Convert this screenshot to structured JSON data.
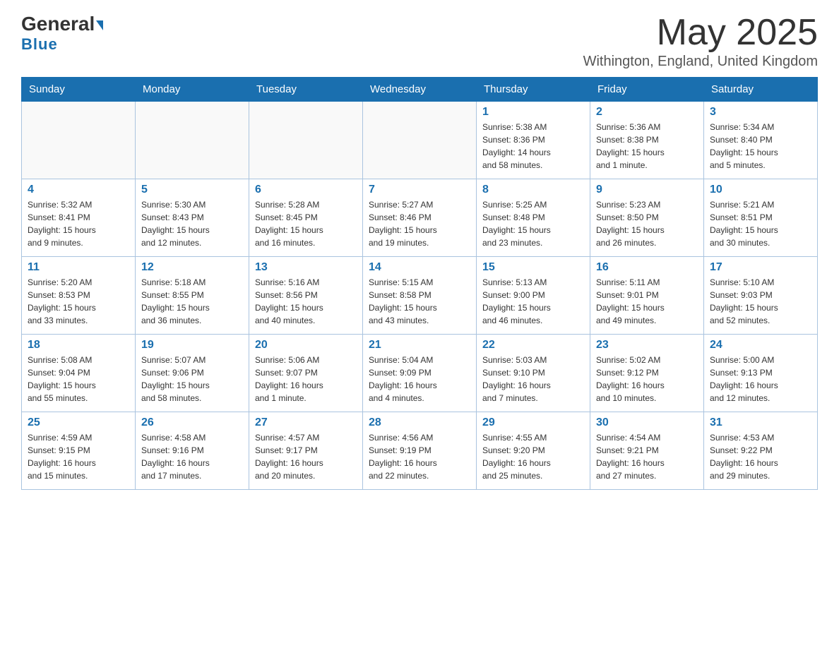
{
  "header": {
    "logo_text1": "General",
    "logo_text2": "Blue",
    "month_title": "May 2025",
    "location": "Withington, England, United Kingdom"
  },
  "weekdays": [
    "Sunday",
    "Monday",
    "Tuesday",
    "Wednesday",
    "Thursday",
    "Friday",
    "Saturday"
  ],
  "weeks": [
    {
      "days": [
        {
          "number": "",
          "info": ""
        },
        {
          "number": "",
          "info": ""
        },
        {
          "number": "",
          "info": ""
        },
        {
          "number": "",
          "info": ""
        },
        {
          "number": "1",
          "info": "Sunrise: 5:38 AM\nSunset: 8:36 PM\nDaylight: 14 hours\nand 58 minutes."
        },
        {
          "number": "2",
          "info": "Sunrise: 5:36 AM\nSunset: 8:38 PM\nDaylight: 15 hours\nand 1 minute."
        },
        {
          "number": "3",
          "info": "Sunrise: 5:34 AM\nSunset: 8:40 PM\nDaylight: 15 hours\nand 5 minutes."
        }
      ]
    },
    {
      "days": [
        {
          "number": "4",
          "info": "Sunrise: 5:32 AM\nSunset: 8:41 PM\nDaylight: 15 hours\nand 9 minutes."
        },
        {
          "number": "5",
          "info": "Sunrise: 5:30 AM\nSunset: 8:43 PM\nDaylight: 15 hours\nand 12 minutes."
        },
        {
          "number": "6",
          "info": "Sunrise: 5:28 AM\nSunset: 8:45 PM\nDaylight: 15 hours\nand 16 minutes."
        },
        {
          "number": "7",
          "info": "Sunrise: 5:27 AM\nSunset: 8:46 PM\nDaylight: 15 hours\nand 19 minutes."
        },
        {
          "number": "8",
          "info": "Sunrise: 5:25 AM\nSunset: 8:48 PM\nDaylight: 15 hours\nand 23 minutes."
        },
        {
          "number": "9",
          "info": "Sunrise: 5:23 AM\nSunset: 8:50 PM\nDaylight: 15 hours\nand 26 minutes."
        },
        {
          "number": "10",
          "info": "Sunrise: 5:21 AM\nSunset: 8:51 PM\nDaylight: 15 hours\nand 30 minutes."
        }
      ]
    },
    {
      "days": [
        {
          "number": "11",
          "info": "Sunrise: 5:20 AM\nSunset: 8:53 PM\nDaylight: 15 hours\nand 33 minutes."
        },
        {
          "number": "12",
          "info": "Sunrise: 5:18 AM\nSunset: 8:55 PM\nDaylight: 15 hours\nand 36 minutes."
        },
        {
          "number": "13",
          "info": "Sunrise: 5:16 AM\nSunset: 8:56 PM\nDaylight: 15 hours\nand 40 minutes."
        },
        {
          "number": "14",
          "info": "Sunrise: 5:15 AM\nSunset: 8:58 PM\nDaylight: 15 hours\nand 43 minutes."
        },
        {
          "number": "15",
          "info": "Sunrise: 5:13 AM\nSunset: 9:00 PM\nDaylight: 15 hours\nand 46 minutes."
        },
        {
          "number": "16",
          "info": "Sunrise: 5:11 AM\nSunset: 9:01 PM\nDaylight: 15 hours\nand 49 minutes."
        },
        {
          "number": "17",
          "info": "Sunrise: 5:10 AM\nSunset: 9:03 PM\nDaylight: 15 hours\nand 52 minutes."
        }
      ]
    },
    {
      "days": [
        {
          "number": "18",
          "info": "Sunrise: 5:08 AM\nSunset: 9:04 PM\nDaylight: 15 hours\nand 55 minutes."
        },
        {
          "number": "19",
          "info": "Sunrise: 5:07 AM\nSunset: 9:06 PM\nDaylight: 15 hours\nand 58 minutes."
        },
        {
          "number": "20",
          "info": "Sunrise: 5:06 AM\nSunset: 9:07 PM\nDaylight: 16 hours\nand 1 minute."
        },
        {
          "number": "21",
          "info": "Sunrise: 5:04 AM\nSunset: 9:09 PM\nDaylight: 16 hours\nand 4 minutes."
        },
        {
          "number": "22",
          "info": "Sunrise: 5:03 AM\nSunset: 9:10 PM\nDaylight: 16 hours\nand 7 minutes."
        },
        {
          "number": "23",
          "info": "Sunrise: 5:02 AM\nSunset: 9:12 PM\nDaylight: 16 hours\nand 10 minutes."
        },
        {
          "number": "24",
          "info": "Sunrise: 5:00 AM\nSunset: 9:13 PM\nDaylight: 16 hours\nand 12 minutes."
        }
      ]
    },
    {
      "days": [
        {
          "number": "25",
          "info": "Sunrise: 4:59 AM\nSunset: 9:15 PM\nDaylight: 16 hours\nand 15 minutes."
        },
        {
          "number": "26",
          "info": "Sunrise: 4:58 AM\nSunset: 9:16 PM\nDaylight: 16 hours\nand 17 minutes."
        },
        {
          "number": "27",
          "info": "Sunrise: 4:57 AM\nSunset: 9:17 PM\nDaylight: 16 hours\nand 20 minutes."
        },
        {
          "number": "28",
          "info": "Sunrise: 4:56 AM\nSunset: 9:19 PM\nDaylight: 16 hours\nand 22 minutes."
        },
        {
          "number": "29",
          "info": "Sunrise: 4:55 AM\nSunset: 9:20 PM\nDaylight: 16 hours\nand 25 minutes."
        },
        {
          "number": "30",
          "info": "Sunrise: 4:54 AM\nSunset: 9:21 PM\nDaylight: 16 hours\nand 27 minutes."
        },
        {
          "number": "31",
          "info": "Sunrise: 4:53 AM\nSunset: 9:22 PM\nDaylight: 16 hours\nand 29 minutes."
        }
      ]
    }
  ]
}
